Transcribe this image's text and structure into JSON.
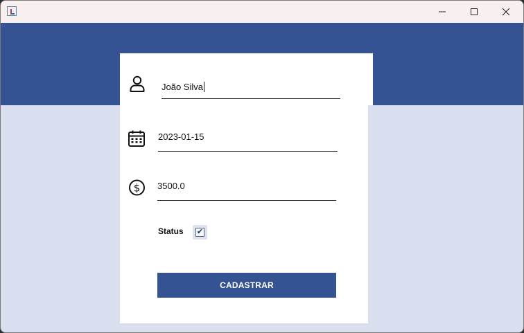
{
  "window": {
    "controls": {
      "minimize_icon": "minimize-icon",
      "maximize_icon": "maximize-icon",
      "close_icon": "close-icon"
    }
  },
  "colors": {
    "header": "#355392",
    "background": "#dadff0",
    "card": "#ffffff",
    "button": "#355392"
  },
  "form": {
    "name": {
      "icon": "user-icon",
      "value": "João Silva"
    },
    "date": {
      "icon": "calendar-icon",
      "value": "2023-01-15"
    },
    "amount": {
      "icon": "dollar-circle-icon",
      "value": "3500.0"
    },
    "status": {
      "label": "Status",
      "checked": true,
      "check_glyph": "✔"
    },
    "submit_label": "CADASTRAR"
  }
}
